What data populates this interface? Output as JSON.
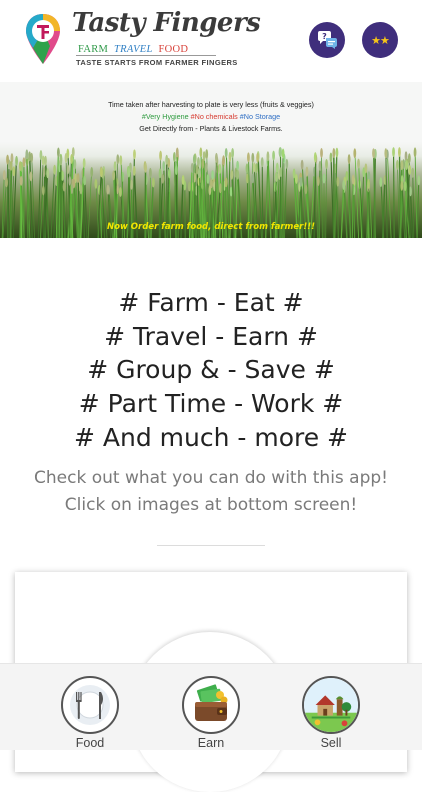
{
  "header": {
    "brand_name": "Tasty Fingers",
    "brand_sub_farm": "FARM",
    "brand_sub_travel": "TRAVEL",
    "brand_sub_food": "FOOD",
    "tagline": "TASTE STARTS FROM FARMER FINGERS",
    "help_button_icon": "help-chat-icon",
    "rate_button_icon": "stars-icon",
    "rate_stars": "★★"
  },
  "banner": {
    "line1": "Time taken after harvesting to plate is very less (fruits & veggies)",
    "tag_hygiene": "#Very Hygiene",
    "tag_chemicals": "#No chemicals",
    "tag_storage": "#No Storage",
    "line3": "Get Directly from  -  Plants & Livestock Farms.",
    "cta": "Now Order farm food, direct from farmer!!!"
  },
  "slogans": [
    "# Farm - Eat #",
    "# Travel - Earn #",
    "# Group & - Save #",
    "# Part Time - Work #",
    "# And much - more #"
  ],
  "info": {
    "line1": "Check out what you can do with this app!",
    "line2": "Click on images at bottom screen!"
  },
  "nav": {
    "items": [
      {
        "label": "Food",
        "icon": "fork-knife-icon"
      },
      {
        "label": "Earn",
        "icon": "wallet-money-icon"
      },
      {
        "label": "Sell",
        "icon": "farm-icon"
      }
    ]
  },
  "colors": {
    "accent": "#3f2e7c",
    "farm_green": "#2f9a49",
    "travel_blue": "#2f7fc4",
    "food_red": "#d8423a",
    "cta_yellow": "#f2e600"
  }
}
